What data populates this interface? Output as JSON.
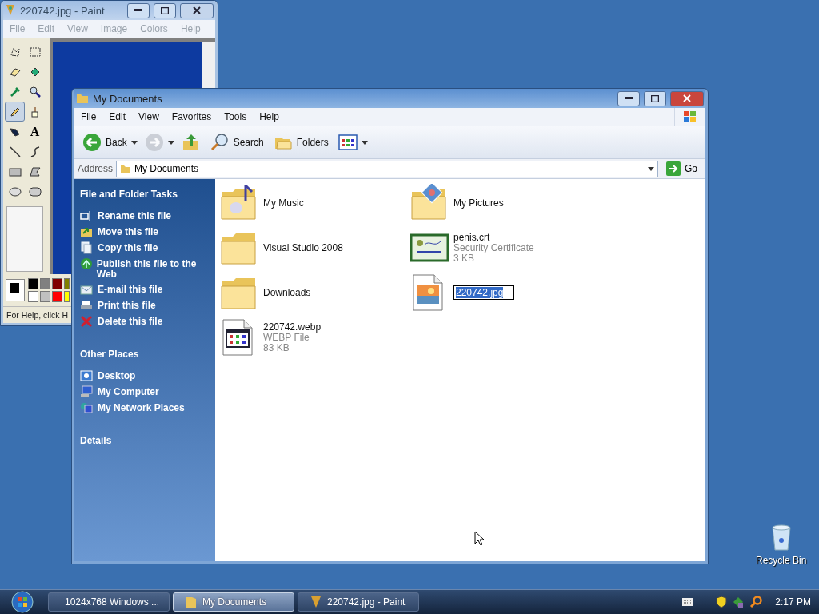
{
  "paint": {
    "title": "220742.jpg - Paint",
    "active": false,
    "menu": [
      "File",
      "Edit",
      "View",
      "Image",
      "Colors",
      "Help"
    ],
    "tools": [
      {
        "kind": "free-select",
        "selected": false
      },
      {
        "kind": "select",
        "selected": false
      },
      {
        "kind": "eraser",
        "selected": false
      },
      {
        "kind": "fill",
        "selected": false
      },
      {
        "kind": "picker",
        "selected": false
      },
      {
        "kind": "magnifier",
        "selected": false
      },
      {
        "kind": "pencil",
        "selected": true
      },
      {
        "kind": "brush",
        "selected": false
      },
      {
        "kind": "airbrush",
        "selected": false
      },
      {
        "kind": "text",
        "glyph": "A",
        "selected": false
      },
      {
        "kind": "line",
        "selected": false
      },
      {
        "kind": "curve",
        "selected": false
      },
      {
        "kind": "rectangle",
        "selected": false
      },
      {
        "kind": "polygon",
        "selected": false
      },
      {
        "kind": "ellipse",
        "selected": false
      },
      {
        "kind": "rounded-rectangle",
        "selected": false
      }
    ],
    "palette": [
      {
        "color": "#000000"
      },
      {
        "color": "#808080"
      },
      {
        "color": "#800000"
      },
      {
        "color": "#808000"
      },
      {
        "color": "#ffffff"
      },
      {
        "color": "#c0c0c0"
      },
      {
        "color": "#ff0000"
      },
      {
        "color": "#ffff00"
      }
    ],
    "status": "For Help, click H"
  },
  "explorer": {
    "title": "My Documents",
    "active": true,
    "menu": [
      "File",
      "Edit",
      "View",
      "Favorites",
      "Tools",
      "Help"
    ],
    "toolbar": [
      {
        "kind": "back",
        "label": "Back",
        "dropdown": true,
        "disabled": false
      },
      {
        "kind": "forward",
        "dropdown": true,
        "disabled": true
      },
      {
        "kind": "up",
        "disabled": false
      },
      {
        "kind": "search",
        "label": "Search",
        "disabled": false
      },
      {
        "kind": "folders",
        "label": "Folders",
        "disabled": false
      },
      {
        "kind": "views",
        "dropdown": true,
        "disabled": false
      }
    ],
    "address": {
      "label": "Address",
      "value": "My Documents",
      "go": "Go"
    },
    "sidebar": [
      {
        "title": "File and Folder Tasks",
        "items": [
          {
            "kind": "rename",
            "label": "Rename this file"
          },
          {
            "kind": "move",
            "label": "Move this file"
          },
          {
            "kind": "copy",
            "label": "Copy this file"
          },
          {
            "kind": "publish",
            "label": "Publish this file to the Web"
          },
          {
            "kind": "email",
            "label": "E-mail this file"
          },
          {
            "kind": "print",
            "label": "Print this file"
          },
          {
            "kind": "delete",
            "label": "Delete this file"
          }
        ]
      },
      {
        "title": "Other Places",
        "items": [
          {
            "kind": "desktop",
            "label": "Desktop"
          },
          {
            "kind": "computer",
            "label": "My Computer"
          },
          {
            "kind": "network",
            "label": "My Network Places"
          }
        ]
      },
      {
        "title": "Details"
      }
    ],
    "files": [
      {
        "kind": "music-folder",
        "name": "My Music",
        "renaming": false
      },
      {
        "kind": "folder",
        "name": "Visual Studio 2008",
        "renaming": false
      },
      {
        "kind": "folder",
        "name": "Downloads",
        "renaming": false
      },
      {
        "kind": "webp",
        "name": "220742.webp",
        "type": "WEBP File",
        "size": "83 KB",
        "renaming": false
      },
      {
        "kind": "pictures-folder",
        "name": "My Pictures",
        "renaming": false
      },
      {
        "kind": "certificate",
        "name": "penis.crt",
        "type": "Security Certificate",
        "size": "3 KB",
        "renaming": false
      },
      {
        "kind": "image",
        "name": "220742.jpg",
        "renaming": true
      }
    ]
  },
  "desktop_icons": [
    {
      "label": "Recycle Bin"
    }
  ],
  "taskbar": {
    "buttons": [
      {
        "kind": "app",
        "label": "1024x768 Windows ...",
        "selected": false
      },
      {
        "kind": "folder",
        "label": "My Documents",
        "selected": true
      },
      {
        "kind": "paint",
        "label": "220742.jpg - Paint",
        "selected": false
      }
    ],
    "clock": "2:17 PM"
  }
}
